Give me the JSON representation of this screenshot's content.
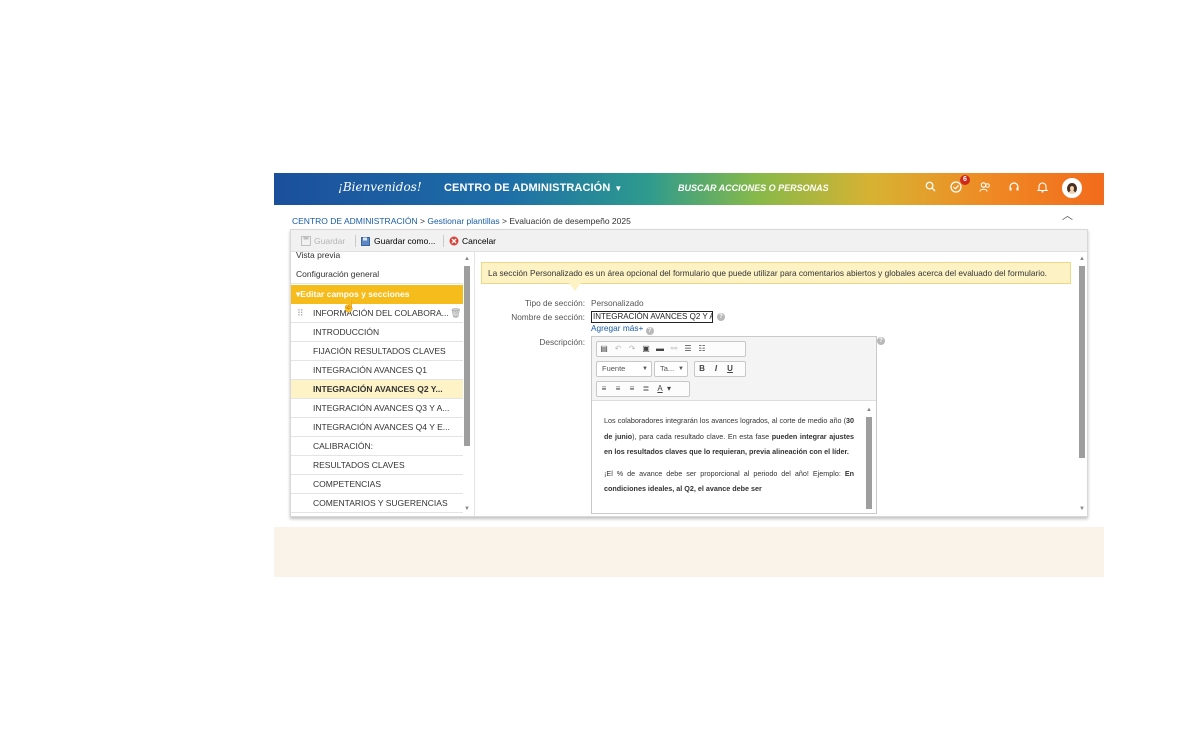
{
  "topbar": {
    "logo": "¡Bienvenidos!",
    "admin_menu": "CENTRO DE ADMINISTRACIÓN",
    "search_prompt": "BUSCAR ACCIONES O PERSONAS",
    "notification_count": "6",
    "icons": [
      "search-icon",
      "approvals-icon",
      "people-icon",
      "headset-icon",
      "bell-icon",
      "user-avatar"
    ]
  },
  "breadcrumb": {
    "root": "CENTRO DE ADMINISTRACIÓN",
    "sep": ">",
    "parent": "Gestionar plantillas",
    "current": "Evaluación de desempeño 2025"
  },
  "toolbar": {
    "save": "Guardar",
    "save_as": "Guardar como...",
    "cancel": "Cancelar"
  },
  "sidebar": {
    "preview": "Vista previa",
    "general_config": "Configuración general",
    "section_head": "Editar campos y secciones",
    "items": [
      "INFORMACIÓN DEL COLABORA...",
      "INTRODUCCIÓN",
      "FIJACIÓN RESULTADOS CLAVES",
      "INTEGRACIÓN AVANCES Q1",
      "INTEGRACIÓN AVANCES Q2 Y...",
      "INTEGRACIÓN AVANCES Q3 Y A...",
      "INTEGRACIÓN AVANCES Q4 Y E...",
      "CALIBRACIÓN:",
      "RESULTADOS CLAVES",
      "COMPETENCIAS",
      "COMENTARIOS Y SUGERENCIAS"
    ],
    "selected_index": 4
  },
  "form": {
    "info_banner": "La sección Personalizado es un área opcional del formulario que puede utilizar para comentarios abiertos y globales acerca del evaluado del formulario.",
    "type_label": "Tipo de sección:",
    "type_value": "Personalizado",
    "name_label": "Nombre de sección:",
    "name_value": "INTEGRACIÓN AVANCES Q2 Y A",
    "add_more": "Agregar más+",
    "desc_label": "Descripción:"
  },
  "editor": {
    "font_select": "Fuente",
    "size_select": "Ta...",
    "bold": "B",
    "italic": "I",
    "underline": "U",
    "text_color": "A",
    "p1_a": "Los colaboradores integrarán los avances logrados, al corte de medio año (",
    "p1_b": "30 de junio",
    "p1_c": "), para cada resultado clave. En esta fase ",
    "p1_d": "pueden integrar ajustes en los resultados claves que lo requieran, previa alineación con el líder.",
    "p2_a": "¡El % de avance debe ser proporcional al periodo del año! Ejemplo: ",
    "p2_b": "En condiciones ideales, al Q2, el avance debe ser"
  }
}
